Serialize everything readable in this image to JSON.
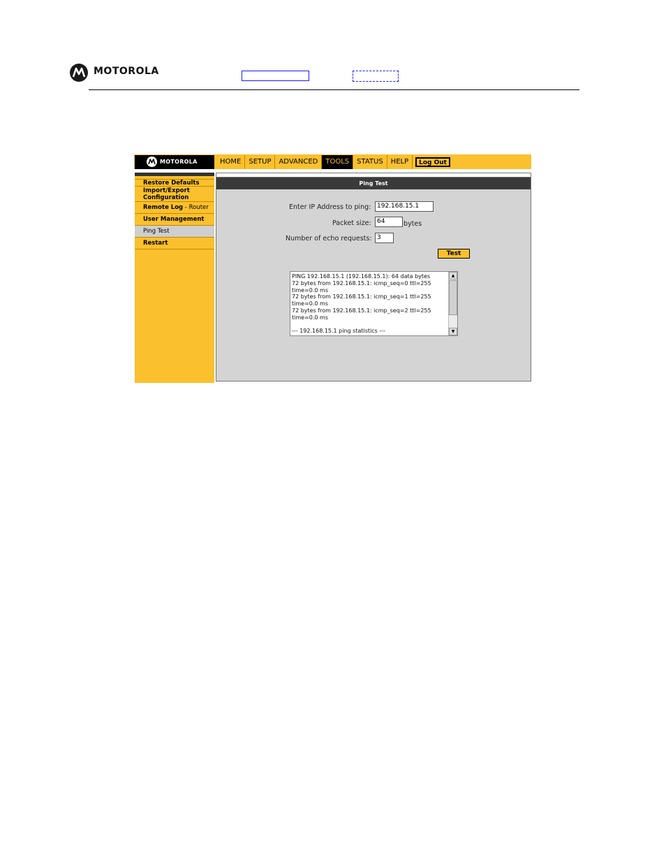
{
  "document": {
    "brand": "MOTOROLA"
  },
  "ui": {
    "logo_text": "MOTOROLA",
    "nav": [
      "HOME",
      "SETUP",
      "ADVANCED",
      "TOOLS",
      "STATUS",
      "HELP"
    ],
    "nav_active": "TOOLS",
    "logout_label": "Log Out",
    "sidebar": {
      "items": [
        {
          "label": "Restore Defaults"
        },
        {
          "label": "Import/Export Configuration"
        },
        {
          "label": "Remote Log",
          "sub": " - Router"
        },
        {
          "label": "User Management"
        },
        {
          "label": "Ping Test",
          "active": true
        },
        {
          "label": "Restart"
        }
      ]
    },
    "page_title": "Ping Test",
    "form": {
      "ip_label": "Enter IP Address to ping:",
      "ip_value": "192.168.15.1",
      "packet_label": "Packet size:",
      "packet_value": "64",
      "packet_unit": "bytes",
      "echo_label": "Number of echo requests:",
      "echo_value": "3",
      "test_button": "Test"
    },
    "output_lines": [
      "PING 192.168.15.1 (192.168.15.1): 64 data bytes",
      "72 bytes from 192.168.15.1: icmp_seq=0 ttl=255",
      "time=0.0 ms",
      "72 bytes from 192.168.15.1: icmp_seq=1 ttl=255",
      "time=0.0 ms",
      "72 bytes from 192.168.15.1: icmp_seq=2 ttl=255",
      "time=0.0 ms",
      "",
      "--- 192.168.15.1 ping statistics ---"
    ],
    "colors": {
      "accent": "#fbc02d",
      "dark": "#000000",
      "panel": "#d4d4d4"
    }
  }
}
